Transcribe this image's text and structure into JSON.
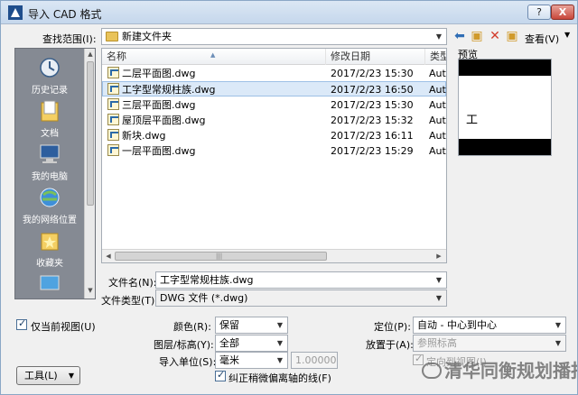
{
  "window": {
    "title": "导入 CAD 格式",
    "help_label": "?",
    "close_label": "X"
  },
  "lookin": {
    "label": "查找范围(I):",
    "value": "新建文件夹",
    "view_label": "查看(V)"
  },
  "places": [
    {
      "label": "历史记录",
      "icon": "history-icon"
    },
    {
      "label": "文档",
      "icon": "documents-icon"
    },
    {
      "label": "我的电脑",
      "icon": "computer-icon"
    },
    {
      "label": "我的网络位置",
      "icon": "network-icon"
    },
    {
      "label": "收藏夹",
      "icon": "favorites-icon"
    },
    {
      "label": "",
      "icon": "desktop-icon"
    }
  ],
  "filelist": {
    "columns": [
      "名称",
      "修改日期",
      "类型"
    ],
    "rows": [
      {
        "name": "二层平面图.dwg",
        "date": "2017/2/23 15:30",
        "type": "Autc",
        "selected": false
      },
      {
        "name": "工字型常规柱族.dwg",
        "date": "2017/2/23 16:50",
        "type": "Autc",
        "selected": true
      },
      {
        "name": "三层平面图.dwg",
        "date": "2017/2/23 15:30",
        "type": "Autc",
        "selected": false
      },
      {
        "name": "屋顶层平面图.dwg",
        "date": "2017/2/23 15:32",
        "type": "Autc",
        "selected": false
      },
      {
        "name": "新块.dwg",
        "date": "2017/2/23 16:11",
        "type": "Autc",
        "selected": false
      },
      {
        "name": "一层平面图.dwg",
        "date": "2017/2/23 15:29",
        "type": "Autc",
        "selected": false
      }
    ]
  },
  "preview": {
    "label": "预览",
    "char": "工"
  },
  "filename": {
    "label": "文件名(N):",
    "value": "工字型常规柱族.dwg"
  },
  "filetype": {
    "label": "文件类型(T):",
    "value": "DWG 文件 (*.dwg)"
  },
  "options": {
    "current_view_only": "仅当前视图(U)",
    "color_label": "颜色(R):",
    "color_value": "保留",
    "layers_label": "图层/标高(Y):",
    "layers_value": "全部",
    "units_label": "导入单位(S):",
    "units_value": "毫米",
    "scale_value": "1.000000",
    "correct_lines": "纠正稍微偏离轴的线(F)",
    "position_label": "定位(P):",
    "position_value": "自动 - 中心到中心",
    "place_at_label": "放置于(A):",
    "place_at_value": "参照标高",
    "orient_label": "定向到视图(I)"
  },
  "tools_label": "工具(L)",
  "watermark": "清华同衡规划播报",
  "colors": {
    "selection": "#dbe9f8",
    "places_bg": "#858a93"
  }
}
